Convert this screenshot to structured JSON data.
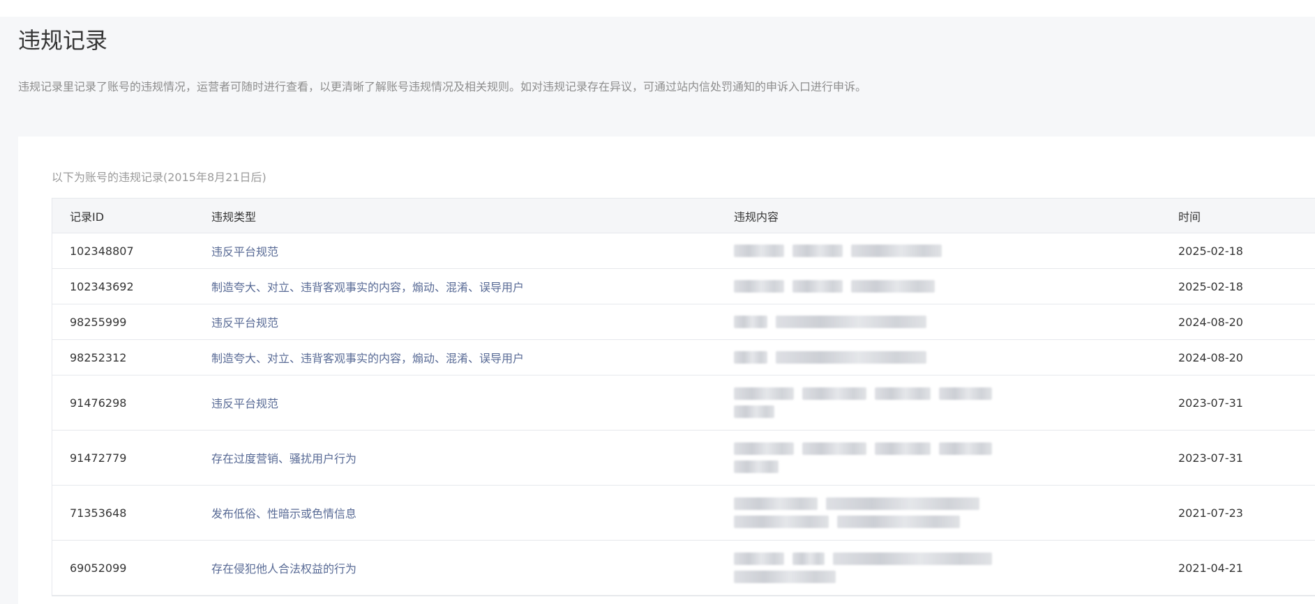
{
  "page": {
    "title": "违规记录",
    "description": "违规记录里记录了账号的违规情况，运营者可随时进行查看，以更清晰了解账号违规情况及相关规则。如对违规记录存在异议，可通过站内信处罚通知的申诉入口进行申诉。"
  },
  "card": {
    "caption": "以下为账号的违规记录(2015年8月21日后)"
  },
  "table": {
    "headers": {
      "id": "记录ID",
      "type": "违规类型",
      "content": "违规内容",
      "time": "时间"
    },
    "rows": [
      {
        "id": "102348807",
        "type": "违反平台规范",
        "time": "2025-02-18"
      },
      {
        "id": "102343692",
        "type": "制造夸大、对立、违背客观事实的内容，煽动、混淆、误导用户",
        "time": "2025-02-18"
      },
      {
        "id": "98255999",
        "type": "违反平台规范",
        "time": "2024-08-20"
      },
      {
        "id": "98252312",
        "type": "制造夸大、对立、违背客观事实的内容，煽动、混淆、误导用户",
        "time": "2024-08-20"
      },
      {
        "id": "91476298",
        "type": "违反平台规范",
        "time": "2023-07-31"
      },
      {
        "id": "91472779",
        "type": "存在过度营销、骚扰用户行为",
        "time": "2023-07-31"
      },
      {
        "id": "71353648",
        "type": "发布低俗、性暗示或色情信息",
        "time": "2021-07-23"
      },
      {
        "id": "69052099",
        "type": "存在侵犯他人合法权益的行为",
        "time": "2021-04-21"
      }
    ]
  },
  "colors": {
    "link": "#586a95",
    "header_bg": "#f5f6f8",
    "page_bg": "#f6f7f9",
    "border": "#e6e8ec"
  }
}
